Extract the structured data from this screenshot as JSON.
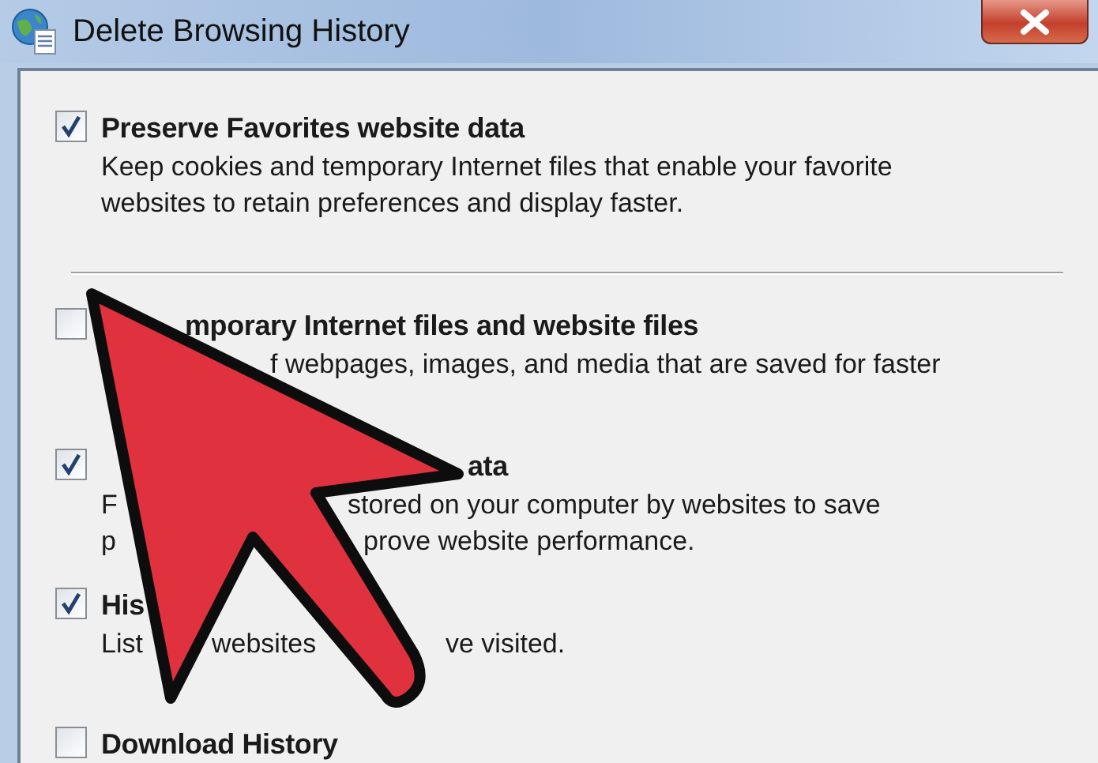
{
  "window": {
    "title": "Delete Browsing History"
  },
  "options": [
    {
      "checked": true,
      "title": [
        "Preserve Favorites website data"
      ],
      "description": [
        [
          "Keep cookies and temporary Internet files that enable your favorite"
        ],
        [
          "websites to retain preferences and display faster."
        ]
      ]
    },
    {
      "checked": false,
      "title": [
        "mporary Internet files and website files"
      ],
      "description": [
        [
          "f webpages, images, and media that are saved for faster"
        ]
      ]
    },
    {
      "checked": true,
      "title": [
        "ata"
      ],
      "description": [
        [
          "F",
          "stored on your computer by websites to save"
        ],
        [
          "p",
          "prove website performance."
        ]
      ]
    },
    {
      "checked": true,
      "title": [
        "His"
      ],
      "description": [
        [
          "List",
          "websites",
          "ve visited."
        ]
      ]
    },
    {
      "checked": false,
      "title": [
        "Download History"
      ]
    }
  ]
}
